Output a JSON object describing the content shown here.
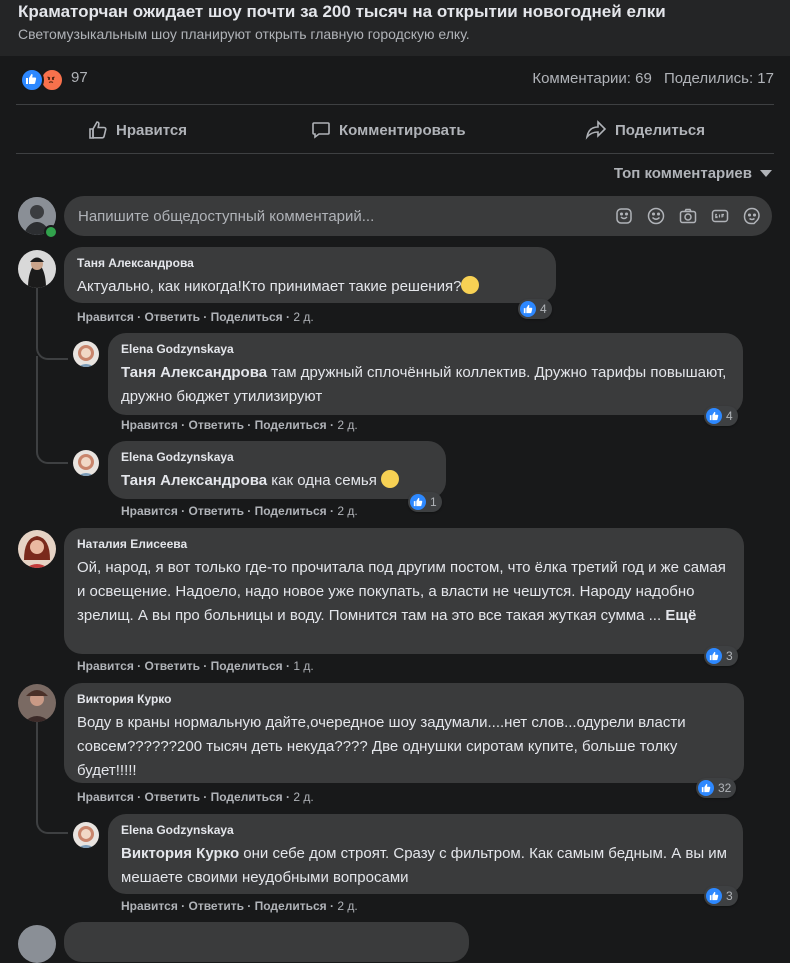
{
  "post": {
    "title": "Краматорчан ожидает шоу почти за 200 тысяч на открытии новогодней елки",
    "subtitle": "Светомузыкальным шоу планируют открыть главную городскую елку."
  },
  "reactions": {
    "count": "97",
    "comments": "Комментарии: 69",
    "shares": "Поделились: 17"
  },
  "actions": {
    "like": "Нравится",
    "comment": "Комментировать",
    "share": "Поделиться"
  },
  "sort_label": "Топ комментариев",
  "comment_input": {
    "placeholder": "Напишите общедоступный комментарий..."
  },
  "meta_labels": {
    "like": "Нравится",
    "reply": "Ответить",
    "share": "Поделиться"
  },
  "comments": [
    {
      "author": "Таня Александрова",
      "text": "Актуально, как никогда!Кто принимает такие решения?",
      "time": "2 д.",
      "likes": "4",
      "replies": [
        {
          "author": "Elena Godzynskaya",
          "mention": "Таня Александрова",
          "text": " там дружный сплочённый коллектив. Дружно тарифы повышают, дружно бюджет утилизируют",
          "time": "2 д.",
          "likes": "4"
        },
        {
          "author": "Elena Godzynskaya",
          "mention": "Таня Александрова",
          "text": " как одна семья",
          "time": "2 д.",
          "likes": "1"
        }
      ]
    },
    {
      "author": "Наталия Елисеева",
      "text": "Ой, народ, я вот только где-то прочитала под другим постом, что ёлка третий год и же самая и освещение. Надоело, надо новое уже покупать, а власти не чешутся. Народу надобно зрелищ. А вы про больницы и воду. Помнится там на это все такая жуткая сумма ...",
      "more": "Ещё",
      "time": "1 д.",
      "likes": "3"
    },
    {
      "author": "Виктория Курко",
      "text": "Воду в краны нормальную дайте,очередное шоу задумали....нет слов...одурели власти совсем??????200 тысяч деть некуда???? Две однушки сиротам купите, больше толку будет!!!!!",
      "time": "2 д.",
      "likes": "32",
      "replies": [
        {
          "author": "Elena Godzynskaya",
          "mention": "Виктория Курко",
          "text": " они себе дом строят. Сразу с фильтром. Как самым бедным. А вы им мешаете своими неудобными вопросами",
          "time": "2 д.",
          "likes": "3"
        }
      ]
    }
  ],
  "colors": {
    "background": "#18191a",
    "panel": "#242526",
    "bubble": "#3a3b3c",
    "text": "#e4e6eb",
    "secondary": "#b0b3b8",
    "like_blue": "#2d88ff",
    "angry_orange": "#f7714c"
  },
  "icons": [
    "like-reaction-icon",
    "angry-reaction-icon",
    "thumbs-up-icon",
    "comment-icon",
    "share-icon",
    "chevron-down-icon",
    "sticker-icon",
    "emoji-icon",
    "camera-icon",
    "gif-icon",
    "avatar-sticker-icon"
  ]
}
